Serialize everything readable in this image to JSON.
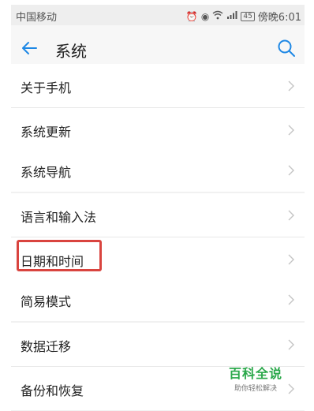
{
  "status_bar": {
    "carrier": "中国移动",
    "icons": [
      "alarm-icon",
      "eye-icon",
      "wifi-icon",
      "signal-icon"
    ],
    "battery": "45",
    "time": "傍晚6:01"
  },
  "header": {
    "title": "系统",
    "back_icon": "arrow-left-icon",
    "search_icon": "search-icon",
    "accent_color": "#1e88e5"
  },
  "groups": [
    {
      "items": [
        {
          "label": "关于手机"
        },
        {
          "label": "系统更新"
        }
      ]
    },
    {
      "items": [
        {
          "label": "系统导航"
        }
      ]
    },
    {
      "items": [
        {
          "label": "语言和输入法"
        },
        {
          "label": "日期和时间"
        }
      ]
    },
    {
      "items": [
        {
          "label": "简易模式"
        }
      ]
    },
    {
      "items": [
        {
          "label": "数据迁移"
        },
        {
          "label": "备份和恢复"
        }
      ]
    }
  ],
  "highlight_color": "#d9443f",
  "watermark": {
    "title": "百科全说",
    "subtitle": "助你轻松解决"
  }
}
